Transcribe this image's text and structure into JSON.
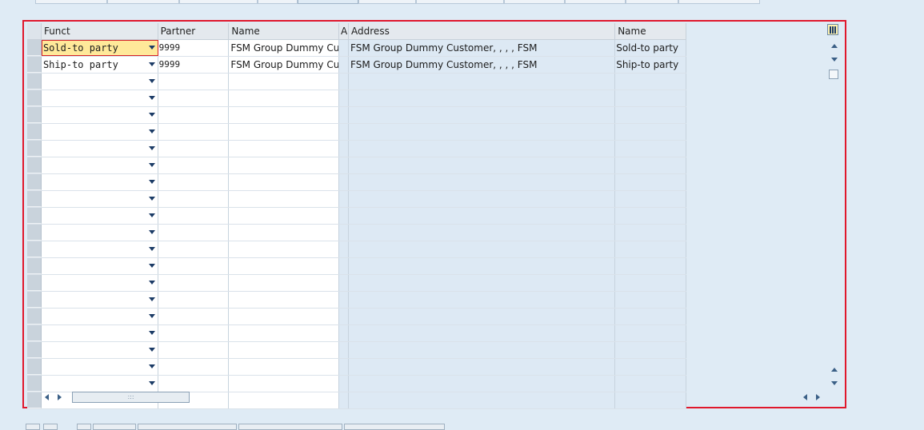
{
  "grid": {
    "headers": {
      "funct": "Funct",
      "partner": "Partner",
      "name": "Name",
      "a": "A",
      "address": "Address",
      "name2": "Name"
    },
    "rows": [
      {
        "funct": "Sold-to party",
        "partner": "9999",
        "name": "FSM Group Dummy Cus…",
        "address": "FSM Group Dummy Customer, , , , FSM",
        "name2": "Sold-to party"
      },
      {
        "funct": "Ship-to party",
        "partner": "9999",
        "name": "FSM Group Dummy Cus…",
        "address": "FSM Group Dummy Customer, , , , FSM",
        "name2": "Ship-to party"
      },
      {
        "funct": "",
        "partner": "",
        "name": "",
        "address": "",
        "name2": ""
      },
      {
        "funct": "",
        "partner": "",
        "name": "",
        "address": "",
        "name2": ""
      },
      {
        "funct": "",
        "partner": "",
        "name": "",
        "address": "",
        "name2": ""
      },
      {
        "funct": "",
        "partner": "",
        "name": "",
        "address": "",
        "name2": ""
      },
      {
        "funct": "",
        "partner": "",
        "name": "",
        "address": "",
        "name2": ""
      },
      {
        "funct": "",
        "partner": "",
        "name": "",
        "address": "",
        "name2": ""
      },
      {
        "funct": "",
        "partner": "",
        "name": "",
        "address": "",
        "name2": ""
      },
      {
        "funct": "",
        "partner": "",
        "name": "",
        "address": "",
        "name2": ""
      },
      {
        "funct": "",
        "partner": "",
        "name": "",
        "address": "",
        "name2": ""
      },
      {
        "funct": "",
        "partner": "",
        "name": "",
        "address": "",
        "name2": ""
      },
      {
        "funct": "",
        "partner": "",
        "name": "",
        "address": "",
        "name2": ""
      },
      {
        "funct": "",
        "partner": "",
        "name": "",
        "address": "",
        "name2": ""
      },
      {
        "funct": "",
        "partner": "",
        "name": "",
        "address": "",
        "name2": ""
      },
      {
        "funct": "",
        "partner": "",
        "name": "",
        "address": "",
        "name2": ""
      },
      {
        "funct": "",
        "partner": "",
        "name": "",
        "address": "",
        "name2": ""
      },
      {
        "funct": "",
        "partner": "",
        "name": "",
        "address": "",
        "name2": ""
      },
      {
        "funct": "",
        "partner": "",
        "name": "",
        "address": "",
        "name2": ""
      },
      {
        "funct": "",
        "partner": "",
        "name": "",
        "address": "",
        "name2": ""
      },
      {
        "funct": "",
        "partner": "",
        "name": "",
        "address": "",
        "name2": ""
      },
      {
        "funct": "",
        "partner": "",
        "name": "",
        "address": "",
        "name2": ""
      }
    ]
  },
  "icons": {
    "layout": "column-layout-icon",
    "dropdown": "chevron-down-icon",
    "scroll_up": "arrow-up-icon",
    "scroll_down": "arrow-down-icon",
    "scroll_left": "arrow-left-icon",
    "scroll_right": "arrow-right-icon"
  },
  "colors": {
    "frame_border": "#e0182c",
    "focused_cell": "#ffe99a",
    "readonly_cell": "#dde9f4",
    "background": "#dfebf5"
  }
}
